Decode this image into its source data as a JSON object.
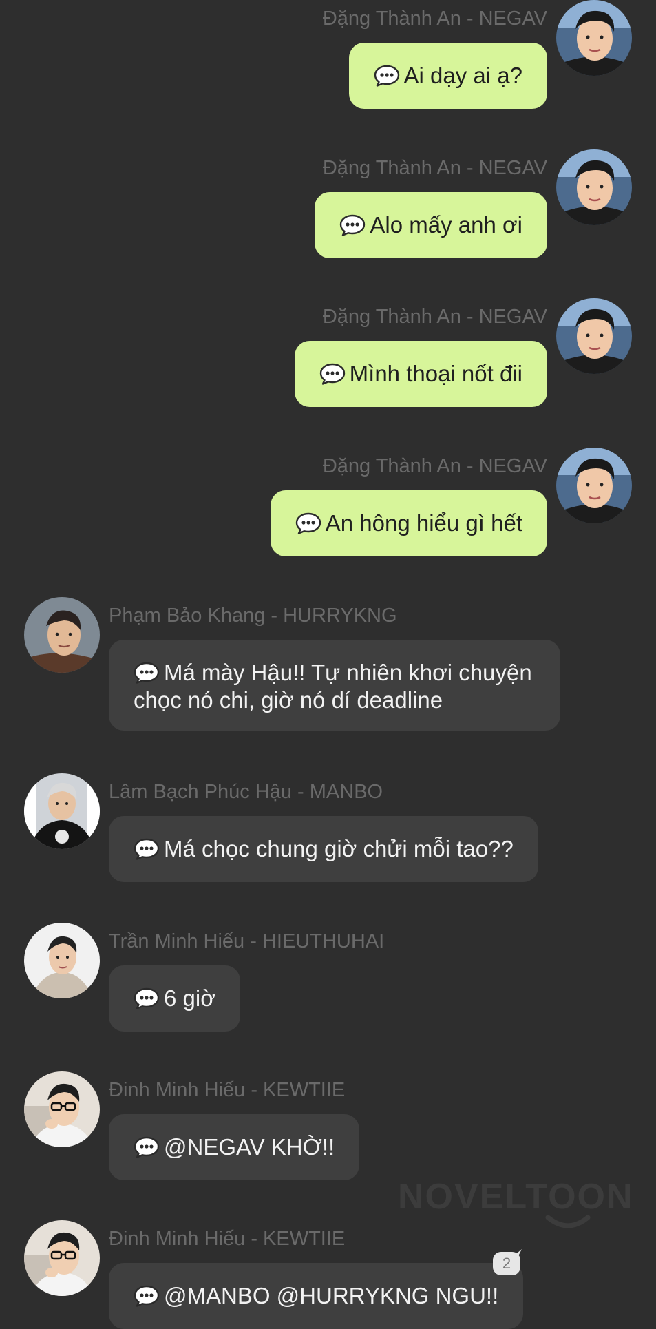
{
  "messages": [
    {
      "sender": "Đặng Thành An - NEGAV",
      "text": "Ai dạy ai ạ?",
      "direction": "out"
    },
    {
      "sender": "Đặng Thành An - NEGAV",
      "text": "Alo mấy anh ơi",
      "direction": "out"
    },
    {
      "sender": "Đặng Thành An - NEGAV",
      "text": "Mình thoại nốt đii",
      "direction": "out"
    },
    {
      "sender": "Đặng Thành An - NEGAV",
      "text": "An hông hiểu gì hết",
      "direction": "out"
    },
    {
      "sender": "Phạm Bảo Khang - HURRYKNG",
      "text_line1": "Má mày Hậu!! Tự nhiên khơi chuyện",
      "text_line2": "chọc nó chi, giờ nó dí deadline",
      "direction": "in"
    },
    {
      "sender": "Lâm Bạch Phúc Hậu - MANBO",
      "text": "Má chọc chung giờ chửi mỗi tao??",
      "direction": "in"
    },
    {
      "sender": "Trần Minh Hiếu - HIEUTHUHAI",
      "text": "6 giờ",
      "direction": "in"
    },
    {
      "sender": "Đinh Minh Hiếu - KEWTIIE",
      "text": "@NEGAV KHỜ!!",
      "direction": "in"
    },
    {
      "sender": "Đinh Minh Hiếu - KEWTIIE",
      "text": "@MANBO @HURRYKNG NGU!!",
      "direction": "in"
    }
  ],
  "watermark": "NOVELTOON",
  "comment_badge": "2",
  "icons": {
    "bubble_icon": "speech-bubble-icon"
  },
  "colors": {
    "background": "#2e2e2e",
    "outgoing_bubble": "#d7f59a",
    "incoming_bubble": "#3f3f3f",
    "sender_text": "#6a6a6a"
  }
}
